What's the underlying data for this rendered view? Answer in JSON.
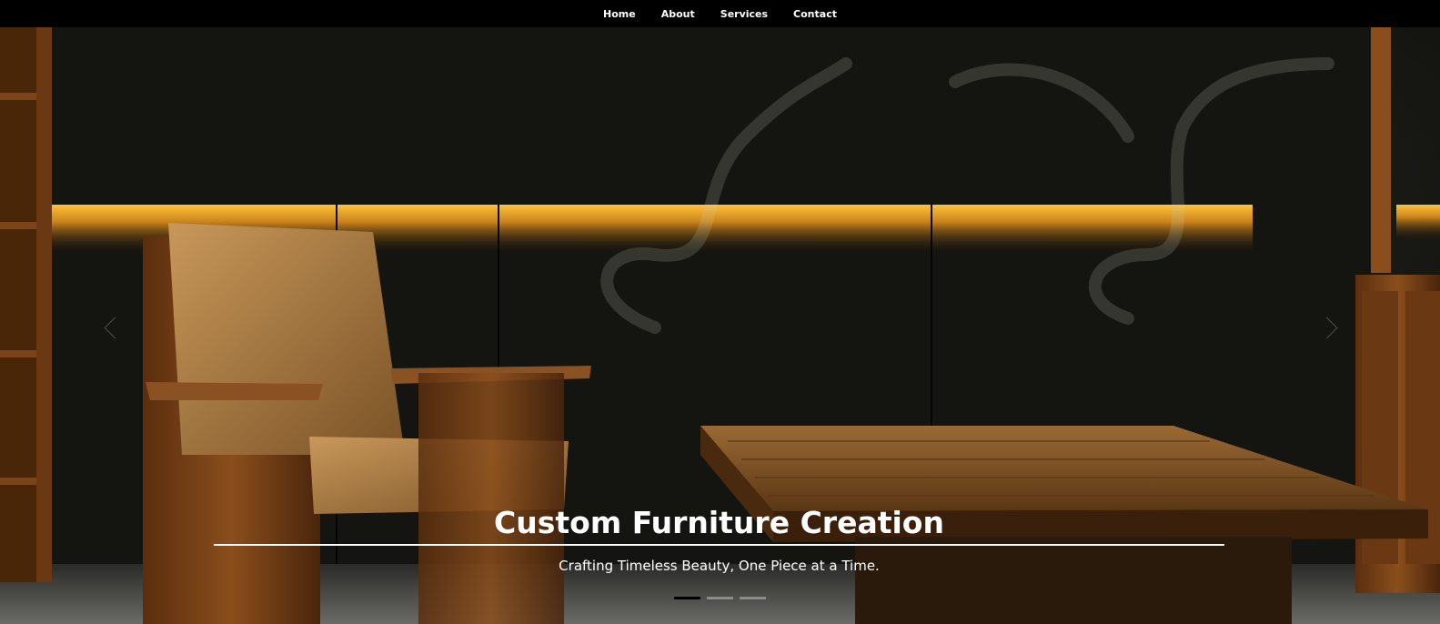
{
  "nav": {
    "links": [
      "Home",
      "About",
      "Services",
      "Contact"
    ]
  },
  "hero": {
    "title": "Custom Furniture Creation",
    "subtitle": "Crafting Timeless Beauty, One Piece at a Time.",
    "slide_count": 3,
    "active_slide": 1
  },
  "colors": {
    "nav_bg": "#000000",
    "glow": "#f0a020",
    "wood": "#7a4418",
    "leather": "#a8783c"
  },
  "icons": {
    "prev": "chevron-left-icon",
    "next": "chevron-right-icon"
  }
}
